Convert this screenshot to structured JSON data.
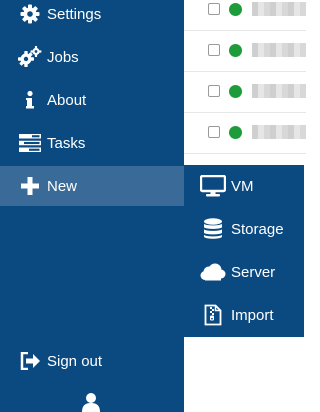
{
  "sidebar": {
    "items": [
      {
        "label": "Settings",
        "icon": "gear-icon"
      },
      {
        "label": "Jobs",
        "icon": "gears-icon"
      },
      {
        "label": "About",
        "icon": "info-icon"
      },
      {
        "label": "Tasks",
        "icon": "tasks-icon"
      },
      {
        "label": "New",
        "icon": "plus-icon"
      }
    ],
    "sign_out": {
      "label": "Sign out",
      "icon": "sign-out-icon"
    },
    "user": {
      "icon": "user-icon"
    }
  },
  "new_menu": {
    "items": [
      {
        "label": "VM",
        "icon": "desktop-icon"
      },
      {
        "label": "Storage",
        "icon": "database-icon"
      },
      {
        "label": "Server",
        "icon": "cloud-icon"
      },
      {
        "label": "Import",
        "icon": "file-archive-icon"
      }
    ]
  },
  "content": {
    "rows": [
      {
        "status": "running"
      },
      {
        "status": "running"
      },
      {
        "status": "running"
      },
      {
        "status": "running"
      }
    ]
  },
  "colors": {
    "sidebar_bg": "#0b4981",
    "active_item_bg": "#3a6b98",
    "status_running": "#1e9c3b",
    "text": "#ffffff"
  }
}
